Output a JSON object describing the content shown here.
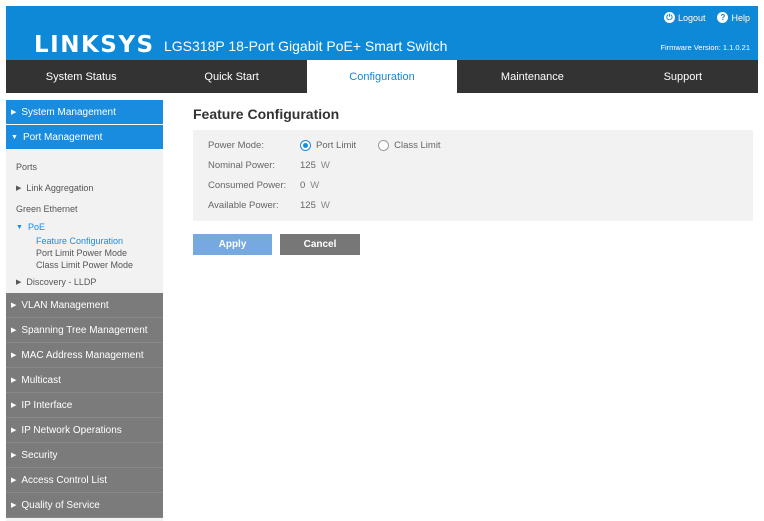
{
  "header": {
    "logo": "LINKSYS",
    "product": "LGS318P 18-Port Gigabit PoE+ Smart Switch",
    "logout_label": "Logout",
    "help_label": "Help",
    "firmware": "Firmware Version: 1.1.0.21",
    "brand_color": "#0e89d8"
  },
  "nav": {
    "tabs": [
      {
        "label": "System Status"
      },
      {
        "label": "Quick Start"
      },
      {
        "label": "Configuration"
      },
      {
        "label": "Maintenance"
      },
      {
        "label": "Support"
      }
    ],
    "active": "Configuration"
  },
  "sidebar": {
    "system_management": "System Management",
    "port_management": "Port Management",
    "ports": "Ports",
    "link_aggregation": "Link Aggregation",
    "green_ethernet": "Green Ethernet",
    "poe": "PoE",
    "feature_configuration": "Feature Configuration",
    "port_limit_power_mode": "Port Limit Power Mode",
    "class_limit_power_mode": "Class Limit Power Mode",
    "discovery_lldp": "Discovery - LLDP",
    "vlan_management": "VLAN Management",
    "spanning_tree": "Spanning Tree Management",
    "mac_address": "MAC Address Management",
    "multicast": "Multicast",
    "ip_interface": "IP Interface",
    "ip_network_operations": "IP Network Operations",
    "security": "Security",
    "access_control_list": "Access Control List",
    "quality_of_service": "Quality of Service"
  },
  "main": {
    "title": "Feature Configuration",
    "power_mode_label": "Power Mode:",
    "port_limit_label": "Port Limit",
    "class_limit_label": "Class Limit",
    "selected_mode": "Port Limit",
    "nominal_label": "Nominal Power:",
    "nominal_value": "125",
    "consumed_label": "Consumed Power:",
    "consumed_value": "0",
    "available_label": "Available Power:",
    "available_value": "125",
    "unit": "W",
    "apply_label": "Apply",
    "cancel_label": "Cancel"
  }
}
